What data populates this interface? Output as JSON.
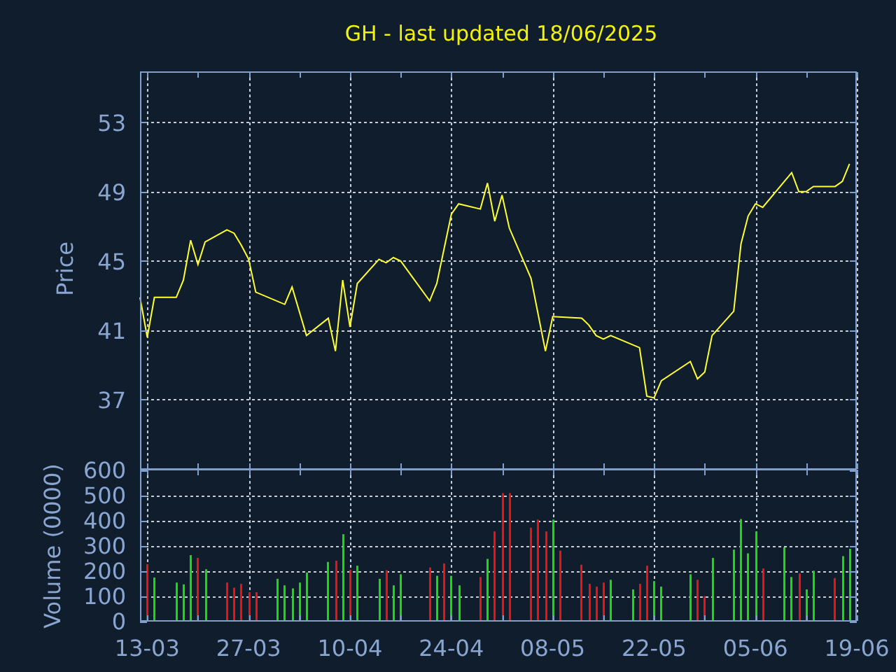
{
  "title": "GH - last updated 18/06/2025",
  "price_panel": {
    "chart_data": {
      "type": "line",
      "ylabel": "Price",
      "x": [
        "2025-03-12",
        "2025-03-13",
        "2025-03-14",
        "2025-03-17",
        "2025-03-18",
        "2025-03-19",
        "2025-03-20",
        "2025-03-21",
        "2025-03-24",
        "2025-03-25",
        "2025-03-26",
        "2025-03-27",
        "2025-03-28",
        "2025-04-01",
        "2025-04-02",
        "2025-04-04",
        "2025-04-07",
        "2025-04-08",
        "2025-04-09",
        "2025-04-10",
        "2025-04-11",
        "2025-04-14",
        "2025-04-15",
        "2025-04-16",
        "2025-04-17",
        "2025-04-21",
        "2025-04-22",
        "2025-04-24",
        "2025-04-25",
        "2025-04-28",
        "2025-04-29",
        "2025-04-30",
        "2025-05-01",
        "2025-05-02",
        "2025-05-05",
        "2025-05-07",
        "2025-05-08",
        "2025-05-12",
        "2025-05-13",
        "2025-05-14",
        "2025-05-15",
        "2025-05-16",
        "2025-05-20",
        "2025-05-21",
        "2025-05-22",
        "2025-05-23",
        "2025-05-27",
        "2025-05-28",
        "2025-05-29",
        "2025-05-30",
        "2025-06-02",
        "2025-06-03",
        "2025-06-04",
        "2025-06-05",
        "2025-06-06",
        "2025-06-10",
        "2025-06-11",
        "2025-06-12",
        "2025-06-13",
        "2025-06-16",
        "2025-06-17",
        "2025-06-18"
      ],
      "series": [
        {
          "color": "#ffff33",
          "values": [
            42.9,
            40.6,
            42.9,
            42.9,
            43.9,
            46.2,
            44.8,
            46.1,
            46.8,
            46.6,
            45.9,
            45.1,
            43.2,
            42.5,
            43.5,
            40.7,
            41.7,
            39.8,
            43.9,
            41.2,
            43.7,
            45.1,
            44.9,
            45.2,
            45.0,
            42.7,
            43.7,
            47.7,
            48.3,
            48.0,
            49.5,
            47.3,
            48.8,
            46.9,
            44.0,
            39.8,
            41.8,
            41.7,
            41.3,
            40.7,
            40.5,
            40.7,
            40.0,
            37.2,
            37.1,
            38.1,
            39.2,
            38.2,
            38.6,
            40.7,
            42.1,
            46.0,
            47.6,
            48.3,
            48.1,
            50.1,
            49.0,
            49.0,
            49.3,
            49.3,
            49.6,
            50.6
          ]
        }
      ],
      "xlim": [
        "2025-03-12",
        "2025-06-19"
      ],
      "ylim": [
        33,
        55.9
      ],
      "yticks": [
        37,
        41,
        45,
        49,
        53
      ],
      "grid": true
    }
  },
  "volume_panel": {
    "chart_data": {
      "type": "bar",
      "ylabel": "Volume (0000)",
      "x": [
        "2025-03-13",
        "2025-03-14",
        "2025-03-17",
        "2025-03-18",
        "2025-03-19",
        "2025-03-20",
        "2025-03-21",
        "2025-03-24",
        "2025-03-25",
        "2025-03-26",
        "2025-03-27",
        "2025-03-28",
        "2025-03-31",
        "2025-04-01",
        "2025-04-02",
        "2025-04-03",
        "2025-04-04",
        "2025-04-07",
        "2025-04-08",
        "2025-04-09",
        "2025-04-10",
        "2025-04-11",
        "2025-04-14",
        "2025-04-15",
        "2025-04-16",
        "2025-04-17",
        "2025-04-21",
        "2025-04-22",
        "2025-04-23",
        "2025-04-24",
        "2025-04-25",
        "2025-04-28",
        "2025-04-29",
        "2025-04-30",
        "2025-05-01",
        "2025-05-02",
        "2025-05-05",
        "2025-05-06",
        "2025-05-07",
        "2025-05-08",
        "2025-05-09",
        "2025-05-12",
        "2025-05-13",
        "2025-05-14",
        "2025-05-15",
        "2025-05-16",
        "2025-05-19",
        "2025-05-20",
        "2025-05-21",
        "2025-05-22",
        "2025-05-23",
        "2025-05-27",
        "2025-05-28",
        "2025-05-29",
        "2025-05-30",
        "2025-06-02",
        "2025-06-03",
        "2025-06-04",
        "2025-06-05",
        "2025-06-06",
        "2025-06-09",
        "2025-06-10",
        "2025-06-11",
        "2025-06-12",
        "2025-06-13",
        "2025-06-16",
        "2025-06-17",
        "2025-06-18"
      ],
      "series": [
        {
          "color": "#11dd11",
          "values": [
            null,
            172,
            152,
            145,
            261,
            null,
            205,
            null,
            null,
            null,
            null,
            null,
            167,
            141,
            129,
            152,
            192,
            234,
            null,
            344,
            null,
            219,
            167,
            null,
            141,
            185,
            null,
            179,
            null,
            179,
            141,
            null,
            246,
            null,
            null,
            null,
            null,
            null,
            null,
            402,
            null,
            null,
            null,
            null,
            null,
            163,
            125,
            null,
            null,
            158,
            136,
            185,
            null,
            null,
            250,
            283,
            404,
            268,
            355,
            null,
            292,
            174,
            null,
            125,
            199,
            null,
            257,
            286
          ]
        },
        {
          "color": "#ee1111",
          "values": [
            225,
            null,
            null,
            null,
            null,
            250,
            null,
            152,
            132,
            147,
            114,
            114,
            null,
            null,
            null,
            null,
            null,
            null,
            239,
            null,
            203,
            null,
            null,
            201,
            null,
            null,
            212,
            null,
            228,
            null,
            null,
            174,
            null,
            355,
            507,
            507,
            370,
            402,
            355,
            null,
            279,
            223,
            147,
            136,
            152,
            null,
            null,
            147,
            219,
            null,
            null,
            null,
            163,
            98,
            null,
            null,
            null,
            null,
            null,
            208,
            null,
            null,
            188,
            null,
            null,
            170,
            null,
            null
          ]
        }
      ],
      "xlim": [
        "2025-03-12",
        "2025-06-19"
      ],
      "ylim": [
        0,
        600
      ],
      "xticks": [
        {
          "value": "2025-03-13",
          "label": "13-03"
        },
        {
          "value": "2025-03-27",
          "label": "27-03"
        },
        {
          "value": "2025-04-10",
          "label": "10-04"
        },
        {
          "value": "2025-04-24",
          "label": "24-04"
        },
        {
          "value": "2025-05-08",
          "label": "08-05"
        },
        {
          "value": "2025-05-22",
          "label": "22-05"
        },
        {
          "value": "2025-06-05",
          "label": "05-06"
        },
        {
          "value": "2025-06-19",
          "label": "19-06"
        }
      ],
      "yticks": [
        0,
        100,
        200,
        300,
        400,
        500,
        600
      ],
      "grid": true
    }
  }
}
